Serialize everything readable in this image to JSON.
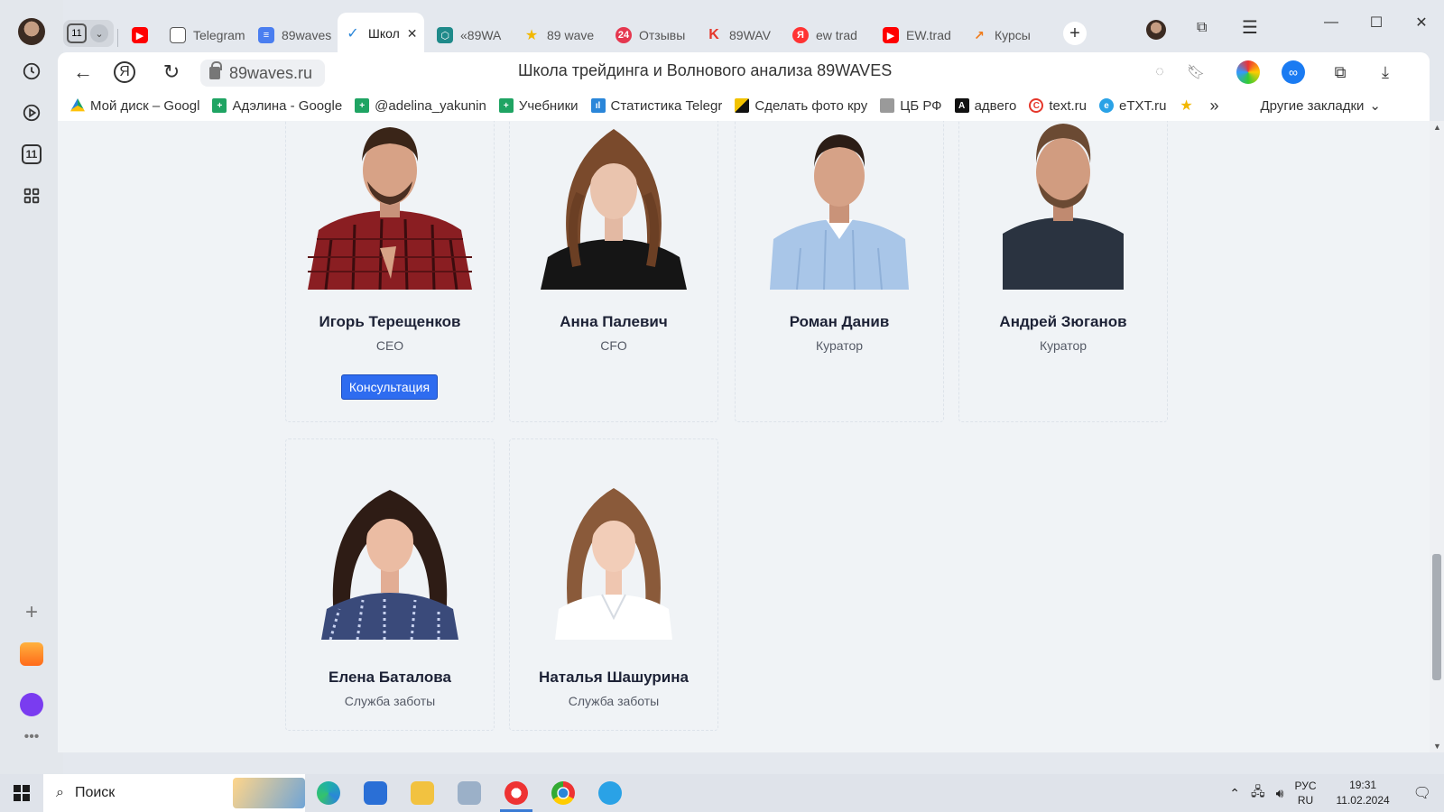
{
  "browser": {
    "tab_group_count": "11",
    "tabs": [
      {
        "label": "",
        "icon": "youtube-icon"
      },
      {
        "label": "Telegram",
        "icon": "document-icon"
      },
      {
        "label": "89waves",
        "icon": "google-docs-icon"
      },
      {
        "label": "Школ",
        "icon": "waves-logo-icon",
        "active": true
      },
      {
        "label": "«89WA",
        "icon": "hexagon-icon"
      },
      {
        "label": "89 wave",
        "icon": "star-icon"
      },
      {
        "label": "Отзывы",
        "icon": "reviews-icon"
      },
      {
        "label": "89WAV",
        "icon": "k-logo-icon"
      },
      {
        "label": "ew trad",
        "icon": "yandex-icon"
      },
      {
        "label": "EW.trad",
        "icon": "youtube-icon"
      },
      {
        "label": "Курсы",
        "icon": "chart-icon"
      }
    ],
    "url": "89waves.ru",
    "page_title": "Школа трейдинга и Волнового анализа 89WAVES",
    "bookmarks": [
      {
        "label": "Мой диск – Googl",
        "color": "#1fa463"
      },
      {
        "label": "Адэлина - Google",
        "color": "#1fa463"
      },
      {
        "label": "@adelina_yakunin",
        "color": "#1fa463"
      },
      {
        "label": "Учебники",
        "color": "#1fa463"
      },
      {
        "label": "Статистика Telegr",
        "color": "#2a86d9"
      },
      {
        "label": "Сделать фото кру",
        "color": "#f2c200"
      },
      {
        "label": "ЦБ РФ",
        "color": "#777777"
      },
      {
        "label": "адвего",
        "color": "#111111"
      },
      {
        "label": "text.ru",
        "color": "#e5372b"
      },
      {
        "label": "eTXT.ru",
        "color": "#2aa2e6"
      },
      {
        "label": "",
        "color": "#f2b800"
      }
    ],
    "more_bookmarks": "»",
    "other_bookmarks": "Другие закладки"
  },
  "team": [
    {
      "name": "Игорь Терещенков",
      "role": "CEO",
      "button": "Консультация"
    },
    {
      "name": "Анна Палевич",
      "role": "CFO"
    },
    {
      "name": "Роман Данив",
      "role": "Куратор"
    },
    {
      "name": "Андрей Зюганов",
      "role": "Куратор"
    },
    {
      "name": "Елена Баталова",
      "role": "Служба заботы"
    },
    {
      "name": "Наталья Шашурина",
      "role": "Служба заботы"
    }
  ],
  "taskbar": {
    "search_placeholder": "Поиск",
    "lang_top": "РУС",
    "lang_bottom": "RU",
    "time": "19:31",
    "date": "11.02.2024"
  },
  "colors": {
    "accent_button": "#2e6cf0",
    "content_bg": "#f0f3f6",
    "name_text": "#1d2236"
  }
}
